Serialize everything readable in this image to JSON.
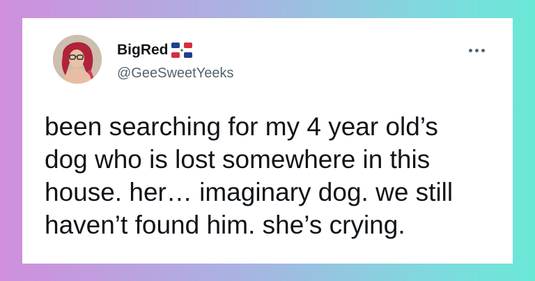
{
  "tweet": {
    "display_name": "BigRed",
    "name_emoji": "flag-dominican-republic-icon",
    "handle": "@GeeSweetYeeks",
    "more_icon": "more-horizontal-icon",
    "text_lines": [
      "been searching for my 4 year old’s",
      "dog who is lost somewhere in this",
      "house. her… imaginary dog. we still",
      "haven’t found him. she’s crying."
    ]
  },
  "colors": {
    "background_gradient": [
      "#d08fdc",
      "#a9b3e2",
      "#7fd9de",
      "#6ae8d7"
    ],
    "card": "#ffffff",
    "text_primary": "#0f1419",
    "text_secondary": "#536471"
  }
}
